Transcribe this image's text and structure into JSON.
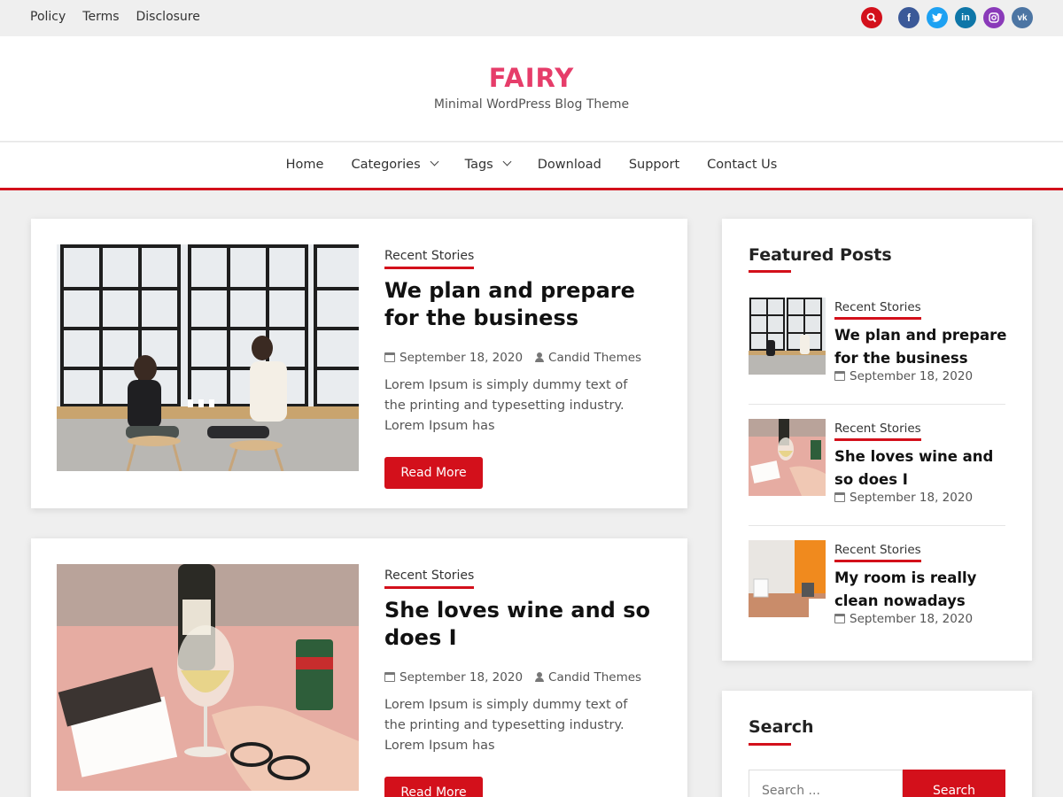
{
  "topbar": {
    "links": [
      "Policy",
      "Terms",
      "Disclosure"
    ],
    "social": [
      {
        "name": "search-icon",
        "glyph": "",
        "color": "#d3101b"
      },
      {
        "name": "facebook-icon",
        "glyph": "f",
        "color": "#3b5998"
      },
      {
        "name": "twitter-icon",
        "glyph": "t",
        "color": "#1da1f2"
      },
      {
        "name": "linkedin-icon",
        "glyph": "in",
        "color": "#0e76a8"
      },
      {
        "name": "instagram-icon",
        "glyph": "◎",
        "color": "#8a3ab9"
      },
      {
        "name": "vk-icon",
        "glyph": "vk",
        "color": "#4c75a3"
      }
    ]
  },
  "header": {
    "title": "FAIRY",
    "tagline": "Minimal WordPress Blog Theme",
    "title_color": "#e63d6a"
  },
  "nav": {
    "items": [
      {
        "label": "Home",
        "dropdown": false
      },
      {
        "label": "Categories",
        "dropdown": true
      },
      {
        "label": "Tags",
        "dropdown": true
      },
      {
        "label": "Download",
        "dropdown": false
      },
      {
        "label": "Support",
        "dropdown": false
      },
      {
        "label": "Contact Us",
        "dropdown": false
      }
    ]
  },
  "posts": [
    {
      "category": "Recent Stories",
      "title": "We plan and prepare for the business",
      "date": "September 18, 2020",
      "author": "Candid Themes",
      "excerpt": "Lorem Ipsum is simply dummy text of the printing and typesetting industry. Lorem Ipsum has",
      "button": "Read More"
    },
    {
      "category": "Recent Stories",
      "title": "She loves wine and so does I",
      "date": "September 18, 2020",
      "author": "Candid Themes",
      "excerpt": "Lorem Ipsum is simply dummy text of the printing and typesetting industry. Lorem Ipsum has",
      "button": "Read More"
    }
  ],
  "sidebar": {
    "featured_title": "Featured Posts",
    "featured": [
      {
        "category": "Recent Stories",
        "title": "We plan and prepare for the business",
        "date": "September 18, 2020"
      },
      {
        "category": "Recent Stories",
        "title": "She loves wine and so does I",
        "date": "September 18, 2020"
      },
      {
        "category": "Recent Stories",
        "title": "My room is really clean nowadays",
        "date": "September 18, 2020"
      }
    ],
    "search_title": "Search",
    "search_placeholder": "Search ...",
    "search_button": "Search"
  },
  "colors": {
    "accent": "#d3101b",
    "brand": "#e63d6a"
  }
}
